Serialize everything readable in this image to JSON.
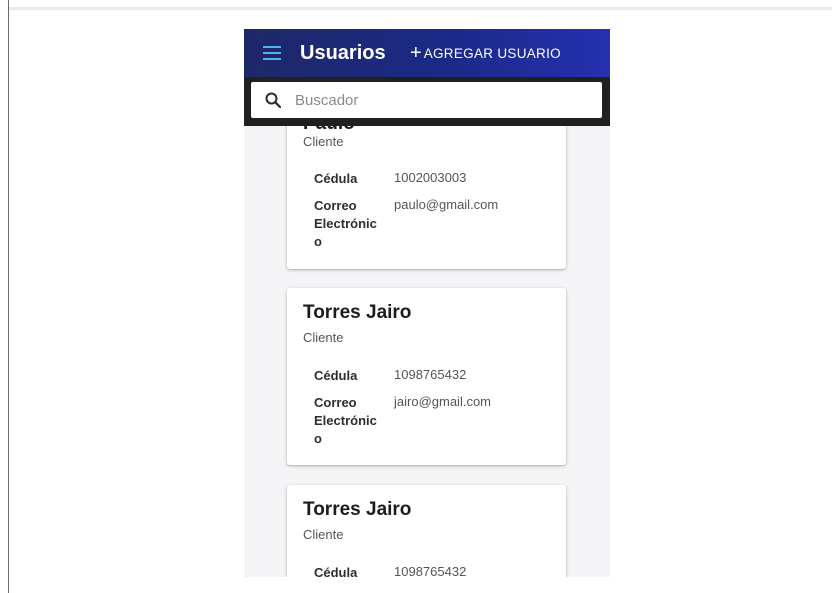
{
  "app_bar": {
    "title": "Usuarios",
    "add_button_icon": "+",
    "add_button_label": "AGREGAR USUARIO"
  },
  "search": {
    "placeholder": "Buscador",
    "value": ""
  },
  "cards": [
    {
      "name": "Paulo",
      "role": "Cliente",
      "cedula_label": "Cédula",
      "cedula": "1002003003",
      "email_label_1": "Correo",
      "email_label_2": "Electrónic",
      "email_label_3": "o",
      "email": "paulo@gmail.com"
    },
    {
      "name": "Torres Jairo",
      "role": "Cliente",
      "cedula_label": "Cédula",
      "cedula": "1098765432",
      "email_label_1": "Correo",
      "email_label_2": "Electrónic",
      "email_label_3": "o",
      "email": "jairo@gmail.com"
    },
    {
      "name": "Torres Jairo",
      "role": "Cliente",
      "cedula_label": "Cédula",
      "cedula": "1098765432"
    }
  ],
  "colors": {
    "app_bar_start": "#1e2868",
    "app_bar_end": "#2530b0",
    "menu_icon": "#4fb3f0",
    "search_strip": "#202020"
  }
}
